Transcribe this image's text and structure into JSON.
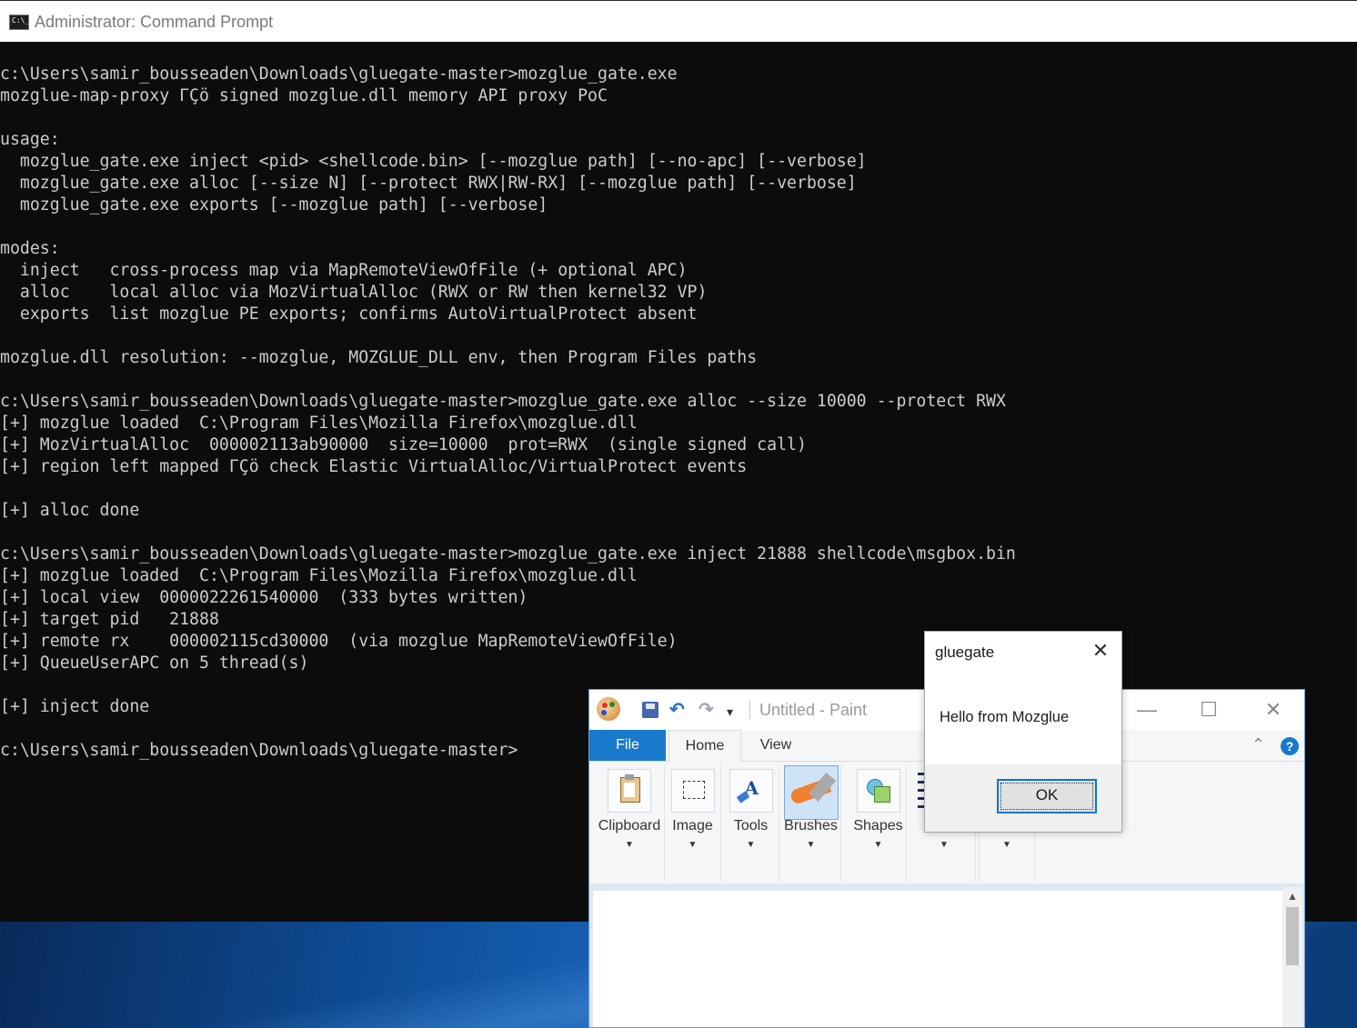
{
  "cmd": {
    "title": "Administrator: Command Prompt",
    "icon_text": "C:\\_",
    "lines": [
      "c:\\Users\\samir_bousseaden\\Downloads\\gluegate-master>mozglue_gate.exe",
      "mozglue-map-proxy ΓÇö signed mozglue.dll memory API proxy PoC",
      "",
      "usage:",
      "  mozglue_gate.exe inject <pid> <shellcode.bin> [--mozglue path] [--no-apc] [--verbose]",
      "  mozglue_gate.exe alloc [--size N] [--protect RWX|RW-RX] [--mozglue path] [--verbose]",
      "  mozglue_gate.exe exports [--mozglue path] [--verbose]",
      "",
      "modes:",
      "  inject   cross-process map via MapRemoteViewOfFile (+ optional APC)",
      "  alloc    local alloc via MozVirtualAlloc (RWX or RW then kernel32 VP)",
      "  exports  list mozglue PE exports; confirms AutoVirtualProtect absent",
      "",
      "mozglue.dll resolution: --mozglue, MOZGLUE_DLL env, then Program Files paths",
      "",
      "c:\\Users\\samir_bousseaden\\Downloads\\gluegate-master>mozglue_gate.exe alloc --size 10000 --protect RWX",
      "[+] mozglue loaded  C:\\Program Files\\Mozilla Firefox\\mozglue.dll",
      "[+] MozVirtualAlloc  000002113ab90000  size=10000  prot=RWX  (single signed call)",
      "[+] region left mapped ΓÇö check Elastic VirtualAlloc/VirtualProtect events",
      "",
      "[+] alloc done",
      "",
      "c:\\Users\\samir_bousseaden\\Downloads\\gluegate-master>mozglue_gate.exe inject 21888 shellcode\\msgbox.bin",
      "[+] mozglue loaded  C:\\Program Files\\Mozilla Firefox\\mozglue.dll",
      "[+] local view  0000022261540000  (333 bytes written)",
      "[+] target pid   21888",
      "[+] remote rx    000002115cd30000  (via mozglue MapRemoteViewOfFile)",
      "[+] QueueUserAPC on 5 thread(s)",
      "",
      "[+] inject done",
      "",
      "c:\\Users\\samir_bousseaden\\Downloads\\gluegate-master>"
    ]
  },
  "paint": {
    "title": "Untitled - Paint",
    "quick_access": {
      "undo": "↶",
      "redo": "↷",
      "customize": "▾"
    },
    "window_controls": {
      "minimize": "—",
      "maximize": "☐",
      "close": "✕"
    },
    "tabs": {
      "file": "File",
      "home": "Home",
      "view": "View"
    },
    "collapse": "⌃",
    "help": "?",
    "groups": [
      {
        "label": "Clipboard",
        "icon": "clipboard-icon",
        "arrow": "▼"
      },
      {
        "label": "Image",
        "icon": "select-icon",
        "arrow": "▼"
      },
      {
        "label": "Tools",
        "icon": "tools-icon",
        "arrow": "▼"
      },
      {
        "label": "Brushes",
        "icon": "brush-icon",
        "arrow": "▼",
        "active": true
      },
      {
        "label": "Shapes",
        "icon": "shapes-icon",
        "arrow": "▼"
      },
      {
        "label": "",
        "icon": "size-icon",
        "arrow": "▼"
      },
      {
        "label": "",
        "icon": "colors-icon",
        "arrow": "▼"
      }
    ],
    "scroll_up": "▲"
  },
  "msgbox": {
    "title": "gluegate",
    "close": "✕",
    "message": "Hello from Mozglue",
    "ok_label": "OK"
  },
  "colors": {
    "terminal_bg": "#0c0c0c",
    "terminal_fg": "#cccccc",
    "paint_accent": "#1979ca",
    "ok_border": "#0078d7"
  }
}
